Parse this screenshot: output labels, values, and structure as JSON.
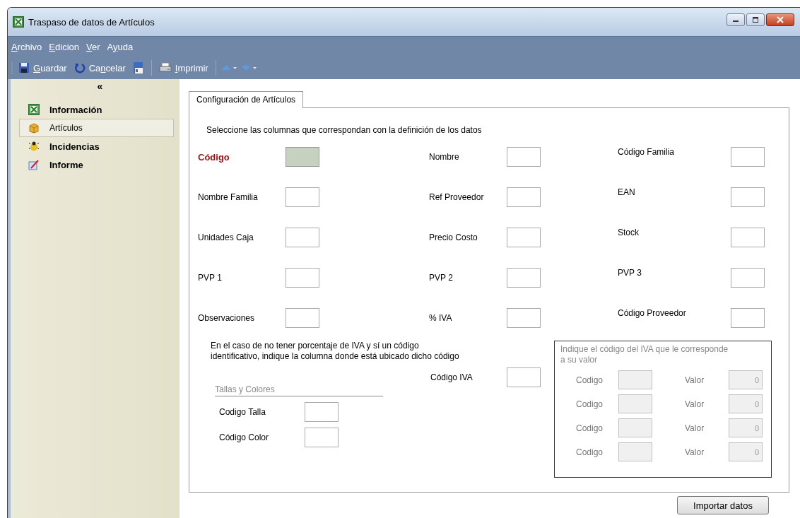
{
  "window": {
    "title": "Traspaso de datos de Artículos"
  },
  "menu": [
    {
      "key": "A",
      "post": "rchivo"
    },
    {
      "key": "E",
      "post": "dicion"
    },
    {
      "key": "V",
      "post": "er"
    },
    {
      "pre": "A",
      "key": "y",
      "post": "uda"
    }
  ],
  "toolbar": [
    {
      "kind": "save",
      "key": "G",
      "post": "uardar"
    },
    {
      "kind": "cancel",
      "pre": "Ca",
      "key": "n",
      "post": "celar"
    },
    {
      "kind": "card"
    },
    {
      "kind": "separator"
    },
    {
      "kind": "print",
      "key": "I",
      "post": "mprimir"
    },
    {
      "kind": "separator"
    },
    {
      "kind": "up"
    },
    {
      "kind": "down"
    }
  ],
  "sidebar": {
    "collapse": "«",
    "items": [
      {
        "label": "Información",
        "kind": "sheet",
        "selected": false
      },
      {
        "label": "Artículos",
        "kind": "box",
        "selected": true
      },
      {
        "label": "Incidencias",
        "kind": "bug",
        "selected": false
      },
      {
        "label": "Informe",
        "kind": "report",
        "selected": false
      }
    ]
  },
  "tab": {
    "label": "Configuración de Artículos",
    "selected": true
  },
  "instruction": "Seleccione las columnas que correspondan con la definición de los datos",
  "fields": [
    {
      "label": "Código",
      "highlighted": true
    },
    {
      "label": "Nombre",
      "highlighted": false
    },
    {
      "label": "Código Familia",
      "highlighted": false
    },
    {
      "label": "Nombre Familia",
      "highlighted": false
    },
    {
      "label": "Ref Proveedor",
      "highlighted": false
    },
    {
      "label": "EAN",
      "highlighted": false
    },
    {
      "label": "Unidades Caja",
      "highlighted": false
    },
    {
      "label": "Precio Costo",
      "highlighted": false
    },
    {
      "label": "Stock",
      "highlighted": false
    },
    {
      "label": "PVP 1",
      "highlighted": false
    },
    {
      "label": "PVP 2",
      "highlighted": false
    },
    {
      "label": "PVP 3",
      "highlighted": false
    },
    {
      "label": "Observaciones",
      "highlighted": false
    },
    {
      "label": "% IVA",
      "highlighted": false
    },
    {
      "label": "Código Proveedor",
      "highlighted": false
    }
  ],
  "iva_note": "En el caso de no tener porcentaje de IVA y sí un código\nidentificativo, indique la columna donde está ubicado dicho código",
  "iva_code": {
    "label": "Código IVA"
  },
  "sizes_colors": {
    "title": "Tallas y Colores",
    "fields": [
      {
        "label": "Codigo Talla"
      },
      {
        "label": "Código Color"
      }
    ]
  },
  "iva_table": {
    "title": "Indique el código del IVA que le corresponde\na su valor",
    "disabled": true,
    "rows": [
      {
        "code_label": "Codigo",
        "value_label": "Valor",
        "value": "0"
      },
      {
        "code_label": "Codigo",
        "value_label": "Valor",
        "value": "0"
      },
      {
        "code_label": "Codigo",
        "value_label": "Valor",
        "value": "0"
      },
      {
        "code_label": "Codigo",
        "value_label": "Valor",
        "value": "0"
      }
    ]
  },
  "import_button": "Importar datos"
}
